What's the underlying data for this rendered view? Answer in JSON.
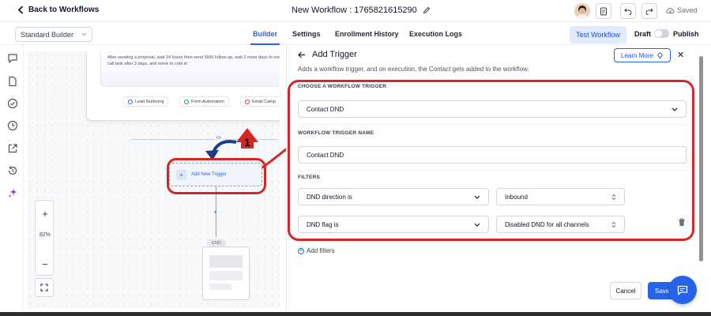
{
  "header": {
    "back_label": "Back to Workflows",
    "workflow_title": "New Workflow : 1765821615290",
    "saved_label": "Saved"
  },
  "subbar": {
    "builder_select": "Standard Builder",
    "tabs": [
      {
        "label": "Builder",
        "active": true
      },
      {
        "label": "Settings",
        "active": false
      },
      {
        "label": "Enrollment History",
        "active": false
      },
      {
        "label": "Execution Logs",
        "active": false
      }
    ],
    "test_workflow_label": "Test Workflow",
    "draft_label": "Draft",
    "publish_label": "Publish"
  },
  "canvas": {
    "node_description": "After sending a proposal, wait 24 hours then send SMS follow-up, wait 2 more days fo create a call task after 3 days, and move to cold st",
    "chips": [
      "Lead Nurturing",
      "Form Automation",
      "Email Camp"
    ],
    "or_label": "Or",
    "add_trigger_label": "Add New Trigger",
    "end_label": "END",
    "zoom_level": "82%",
    "annotation_number": "1"
  },
  "panel": {
    "title": "Add Trigger",
    "subtitle": "Adds a workflow trigger, and on execution, the Contact gets added to the workflow.",
    "learn_more_label": "Learn More",
    "choose_trigger_label": "CHOOSE A WORKFLOW TRIGGER",
    "trigger_value": "Contact DND",
    "trigger_name_label": "WORKFLOW TRIGGER NAME",
    "trigger_name_value": "Contact DND",
    "filters_label": "FILTERS",
    "filters": [
      {
        "field": "DND direction is",
        "value": "Inbound"
      },
      {
        "field": "DND flag is",
        "value": "Disabled DND for all channels"
      }
    ],
    "add_filters_label": "Add filters",
    "cancel_label": "Cancel",
    "save_label": "Save"
  },
  "colors": {
    "accent": "#2563eb",
    "annotation_red": "#d62728"
  }
}
